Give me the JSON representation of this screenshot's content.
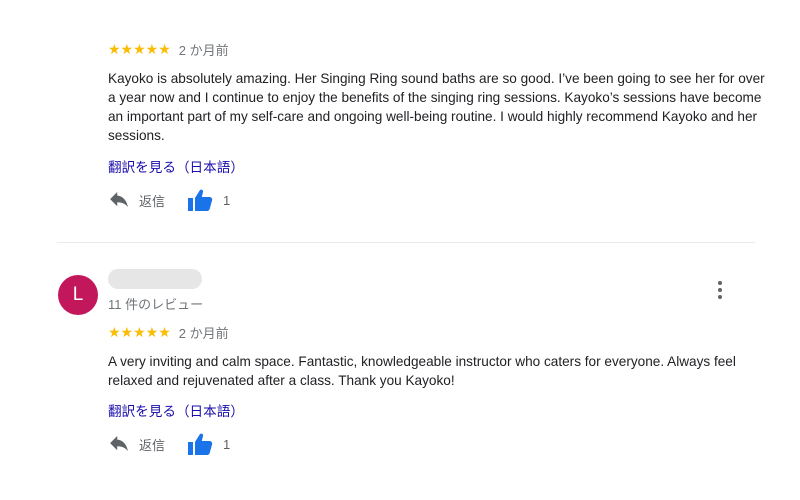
{
  "reviews": [
    {
      "stars": "★★★★★",
      "time": "2 か月前",
      "text": "Kayoko is absolutely amazing. Her Singing Ring sound baths are so good. I’ve been going to see her for over a year now and I continue to enjoy the benefits of the singing ring sessions. Kayoko’s sessions have become an important part of my self-care and ongoing well-being routine. I would highly recommend Kayoko and her sessions.",
      "translate_label": "翻訳を見る（日本語）",
      "reply_label": "返信",
      "like_count": "1"
    },
    {
      "avatar_letter": "L",
      "reviewer_meta": "11 件のレビュー",
      "stars": "★★★★★",
      "time": "2 か月前",
      "text": "A very inviting and calm space. Fantastic, knowledgeable instructor who caters for everyone. Always feel relaxed and rejuvenated after a class. Thank you Kayoko!",
      "translate_label": "翻訳を見る（日本語）",
      "reply_label": "返信",
      "like_count": "1"
    }
  ],
  "rating_value": 5,
  "colors": {
    "star": "#fbbc04",
    "link": "#1a0dab",
    "like": "#1a73e8",
    "avatar": "#c2185b"
  },
  "icons": [
    "reply-icon",
    "thumbs-up-icon",
    "more-vert-icon"
  ]
}
